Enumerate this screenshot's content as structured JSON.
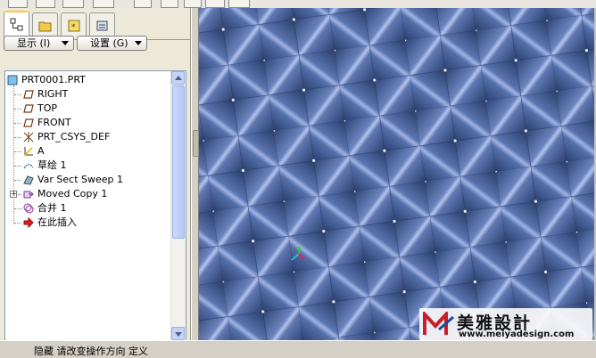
{
  "dropdowns": {
    "show_label": "显示 (I)",
    "settings_label": "设置 (G)"
  },
  "model_tree": {
    "root": "PRT0001.PRT",
    "items": [
      {
        "label": "RIGHT",
        "icon": "datum-plane-icon"
      },
      {
        "label": "TOP",
        "icon": "datum-plane-icon"
      },
      {
        "label": "FRONT",
        "icon": "datum-plane-icon"
      },
      {
        "label": "PRT_CSYS_DEF",
        "icon": "coordinate-system-icon"
      },
      {
        "label": "A",
        "icon": "datum-axis-icon"
      },
      {
        "label": "草绘 1",
        "icon": "sketch-icon"
      },
      {
        "label": "Var Sect Sweep 1",
        "icon": "sweep-icon"
      },
      {
        "label": "Moved Copy 1",
        "icon": "copy-icon"
      },
      {
        "label": "合并 1",
        "icon": "merge-icon"
      },
      {
        "label": "在此插入",
        "icon": "insert-here-arrow-icon"
      }
    ]
  },
  "status_bar": {
    "message": "隐藏 请改变操作方向 定义"
  },
  "watermark": {
    "brand": "美雅設計",
    "url": "www.meiyadesign.com"
  },
  "colors": {
    "viewport_base": "#36507f",
    "tile_highlight": "#a7b8e6",
    "logo_red": "#c81e28"
  }
}
